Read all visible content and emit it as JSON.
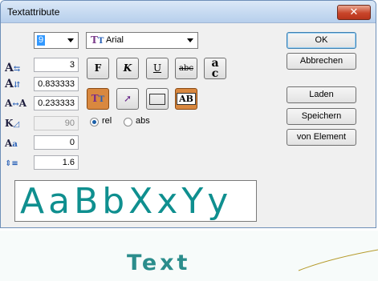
{
  "window": {
    "title": "Textattribute",
    "close_glyph": "✕"
  },
  "size_combo": {
    "value": "9"
  },
  "font_combo": {
    "icon": "truetype-font-icon",
    "value": "Arial"
  },
  "fields": {
    "width": "3",
    "height": "0.833333",
    "spacing": "0.233333",
    "slant": "90",
    "angle": "0",
    "line_spacing": "1.6"
  },
  "style_buttons": {
    "bold": "F",
    "italic": "K",
    "underline": "U",
    "strike": "abc",
    "case_a": "a",
    "case_c": "c",
    "frame_label": "AB"
  },
  "radios": {
    "rel": "rel",
    "abs": "abs",
    "selected": "rel"
  },
  "buttons": {
    "ok": "OK",
    "cancel": "Abbrechen",
    "load": "Laden",
    "save": "Speichern",
    "from_element": "von Element"
  },
  "preview": {
    "text": "AaBbXxYy"
  },
  "background": {
    "text": "Text"
  },
  "colors": {
    "accent": "#0f8f8f",
    "active_button": "#d9883f"
  }
}
